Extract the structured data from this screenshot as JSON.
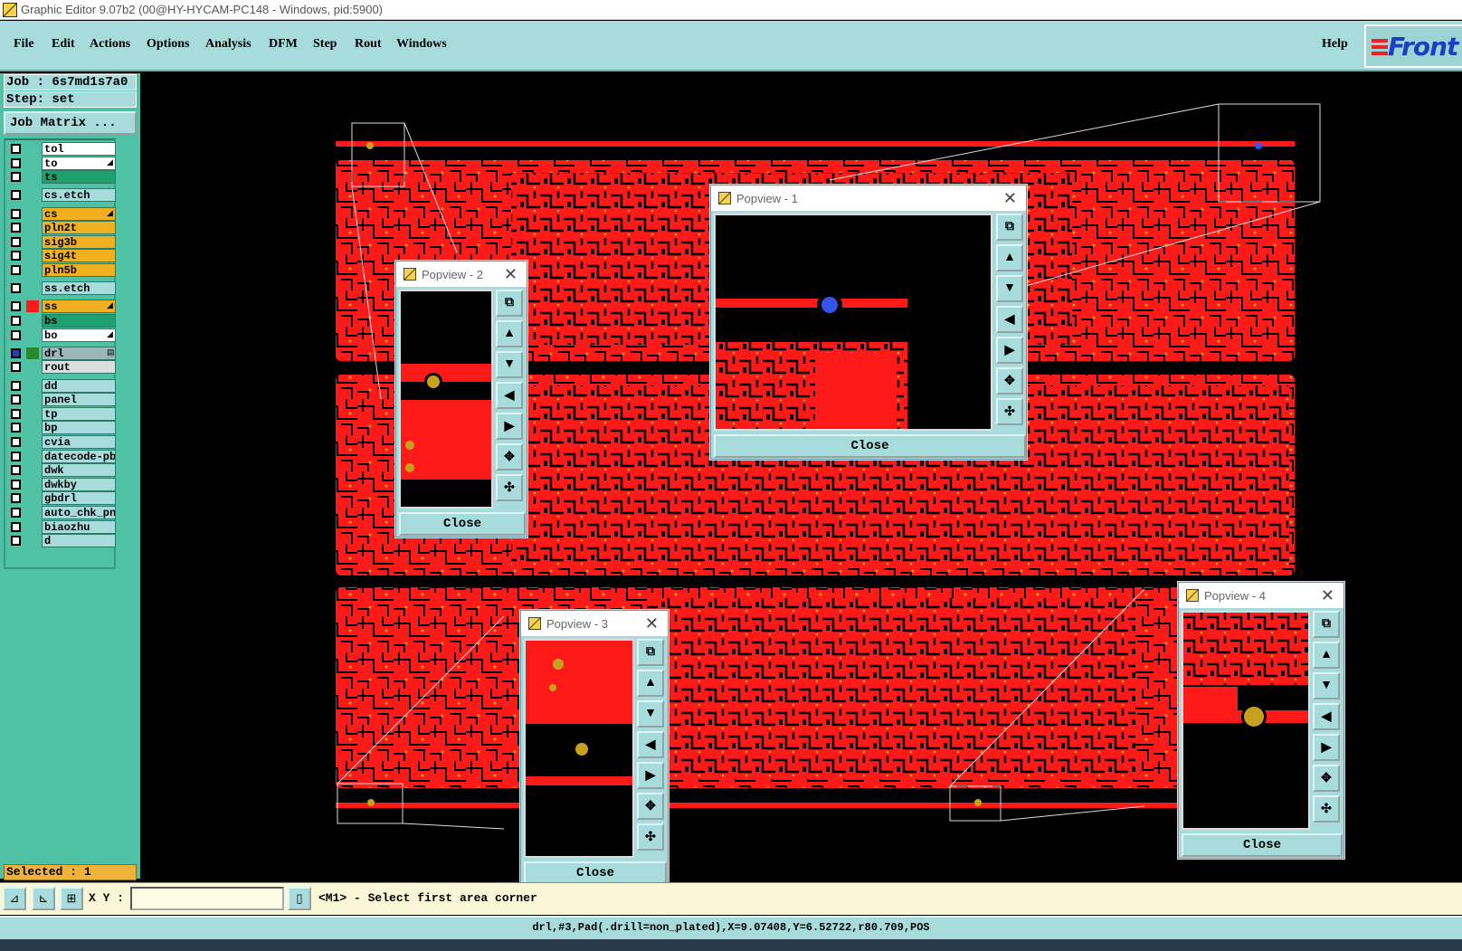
{
  "window": {
    "title": "Graphic Editor 9.07b2 (00@HY-HYCAM-PC148 - Windows, pid:5900)"
  },
  "menu": {
    "items": [
      "File",
      "Edit",
      "Actions",
      "Options",
      "Analysis",
      "DFM",
      "Step",
      "Rout",
      "Windows"
    ],
    "help": "Help",
    "logo": "Front"
  },
  "job": {
    "job_line": "Job : 6s7md1s7a0",
    "step_line": "Step: set",
    "matrix_button": "Job Matrix ..."
  },
  "layers": [
    {
      "name": "tol",
      "color": "#ffffff",
      "mark": ""
    },
    {
      "name": "to",
      "color": "#ffffff",
      "mark": "◢"
    },
    {
      "name": "ts",
      "color": "#20a070",
      "mark": ""
    },
    {
      "name": "cs.etch",
      "color": "#a8dcdc",
      "mark": ""
    },
    {
      "name": "cs",
      "color": "#f0b020",
      "mark": "◢"
    },
    {
      "name": "pln2t",
      "color": "#f0b020",
      "mark": ""
    },
    {
      "name": "sig3b",
      "color": "#f0b020",
      "mark": ""
    },
    {
      "name": "sig4t",
      "color": "#f0b020",
      "mark": ""
    },
    {
      "name": "pln5b",
      "color": "#f0b020",
      "mark": ""
    },
    {
      "name": "ss.etch",
      "color": "#a8dcdc",
      "mark": ""
    },
    {
      "name": "ss",
      "color": "#f0b020",
      "mark": "◢"
    },
    {
      "name": "bs",
      "color": "#20a070",
      "mark": ""
    },
    {
      "name": "bo",
      "color": "#ffffff",
      "mark": "◢"
    },
    {
      "name": "drl",
      "color": "#9ab8b8",
      "mark": "▤"
    },
    {
      "name": "rout",
      "color": "#dddddd",
      "mark": ""
    },
    {
      "name": "dd",
      "color": "#a8dcdc",
      "mark": ""
    },
    {
      "name": "panel",
      "color": "#a8dcdc",
      "mark": ""
    },
    {
      "name": "tp",
      "color": "#a8dcdc",
      "mark": ""
    },
    {
      "name": "bp",
      "color": "#a8dcdc",
      "mark": ""
    },
    {
      "name": "cvia",
      "color": "#a8dcdc",
      "mark": ""
    },
    {
      "name": "datecode-pbe",
      "color": "#a8dcdc",
      "mark": ""
    },
    {
      "name": "dwk",
      "color": "#a8dcdc",
      "mark": ""
    },
    {
      "name": "dwkby",
      "color": "#a8dcdc",
      "mark": ""
    },
    {
      "name": "gbdrl",
      "color": "#a8dcdc",
      "mark": ""
    },
    {
      "name": "auto_chk_pnl",
      "color": "#a8dcdc",
      "mark": ""
    },
    {
      "name": "biaozhu",
      "color": "#a8dcdc",
      "mark": ""
    },
    {
      "name": "d",
      "color": "#a8dcdc",
      "mark": ""
    }
  ],
  "selected": "Selected : 1",
  "popviews": [
    {
      "title": "Popview - 1",
      "close": "Close"
    },
    {
      "title": "Popview - 2",
      "close": "Close"
    },
    {
      "title": "Popview - 3",
      "close": "Close"
    },
    {
      "title": "Popview - 4",
      "close": "Close"
    }
  ],
  "bottom": {
    "xy_label": "X Y :",
    "xy_value": "",
    "prompt": "<M1> - Select first area corner",
    "status": "drl,#3,Pad(.drill=non_plated),X=9.07408,Y=6.52722,r80.709,POS"
  },
  "colors": {
    "copper": "#ff1a1a",
    "pad": "#c8a020",
    "panel_bg": "#a8dcdc"
  }
}
